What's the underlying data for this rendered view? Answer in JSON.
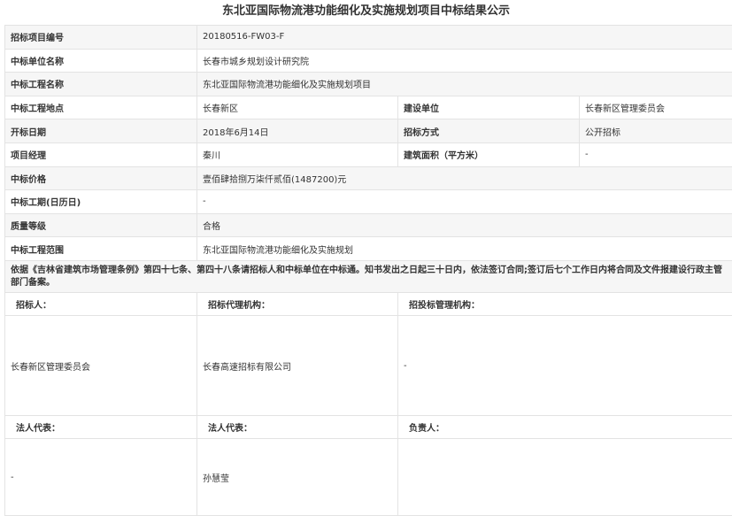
{
  "title": "东北亚国际物流港功能细化及实施规划项目中标结果公示",
  "rows": [
    {
      "l1": "招标项目编号",
      "v1": "20180516-FW03-F"
    },
    {
      "l1": "中标单位名称",
      "v1": "长春市城乡规划设计研究院"
    },
    {
      "l1": "中标工程名称",
      "v1": "东北亚国际物流港功能细化及实施规划项目"
    },
    {
      "l1": "中标工程地点",
      "v1": "长春新区",
      "l2": "建设单位",
      "v2": "长春新区管理委员会"
    },
    {
      "l1": "开标日期",
      "v1": "2018年6月14日",
      "l2": "招标方式",
      "v2": "公开招标"
    },
    {
      "l1": "项目经理",
      "v1": "秦川",
      "l2": "建筑面积（平方米）",
      "v2": "-"
    },
    {
      "l1": "中标价格",
      "v1": "壹佰肆拾捌万柒仟贰佰(1487200)元"
    },
    {
      "l1": "中标工期(日历日)",
      "v1": "-"
    },
    {
      "l1": "质量等级",
      "v1": "合格"
    },
    {
      "l1": "中标工程范围",
      "v1": "东北亚国际物流港功能细化及实施规划"
    }
  ],
  "notice": "依据《吉林省建筑市场管理条例》第四十七条、第四十八条请招标人和中标单位在中标通。知书发出之日起三十日内，依法签订合同;签订后七个工作日内将合同及文件报建设行政主管部门备案。",
  "sign": {
    "h1": "招标人：",
    "h2": "招标代理机构：",
    "h3": "招投标管理机构：",
    "v1": "长春新区管理委员会",
    "v2": "长春高速招标有限公司",
    "v3": "-",
    "h4": "法人代表：",
    "h5": "法人代表：",
    "h6": "负责人：",
    "v4": "-",
    "v5": "孙慧莹",
    "v6": ""
  }
}
